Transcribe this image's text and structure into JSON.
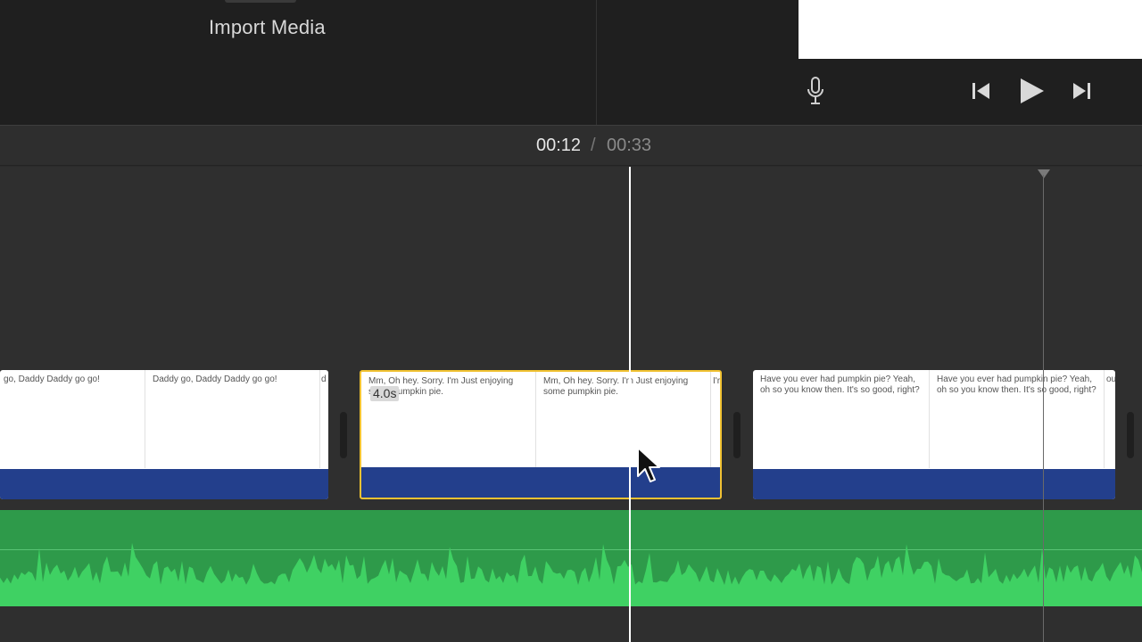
{
  "header": {
    "import_label": "Import Media"
  },
  "controls": {
    "mic_icon": "microphone-icon",
    "prev_icon": "skip-back-icon",
    "play_icon": "play-icon",
    "next_icon": "skip-forward-icon"
  },
  "timecode": {
    "current": "00:12",
    "separator": "/",
    "total": "00:33"
  },
  "clips": [
    {
      "captions": [
        "go, Daddy Daddy go go!",
        "Daddy go, Daddy Daddy go go!",
        "d"
      ]
    },
    {
      "captions": [
        "Mm, Oh hey. Sorry. I'm Just enjoying some pumpkin pie.",
        "Mm, Oh hey. Sorry. I'm Just enjoying some pumpkin pie.",
        "I'r"
      ],
      "duration": "4.0s",
      "selected": true
    },
    {
      "captions": [
        "Have you ever had pumpkin pie? Yeah, oh so you know then. It's so good, right?",
        "Have you ever had pumpkin pie? Yeah, oh so you know then. It's so good, right?",
        "ou"
      ]
    }
  ],
  "colors": {
    "accent_selection": "#f1c232",
    "clip_audio": "#233f8c",
    "music_track": "#2e9a4a",
    "waveform": "#3fd163"
  }
}
